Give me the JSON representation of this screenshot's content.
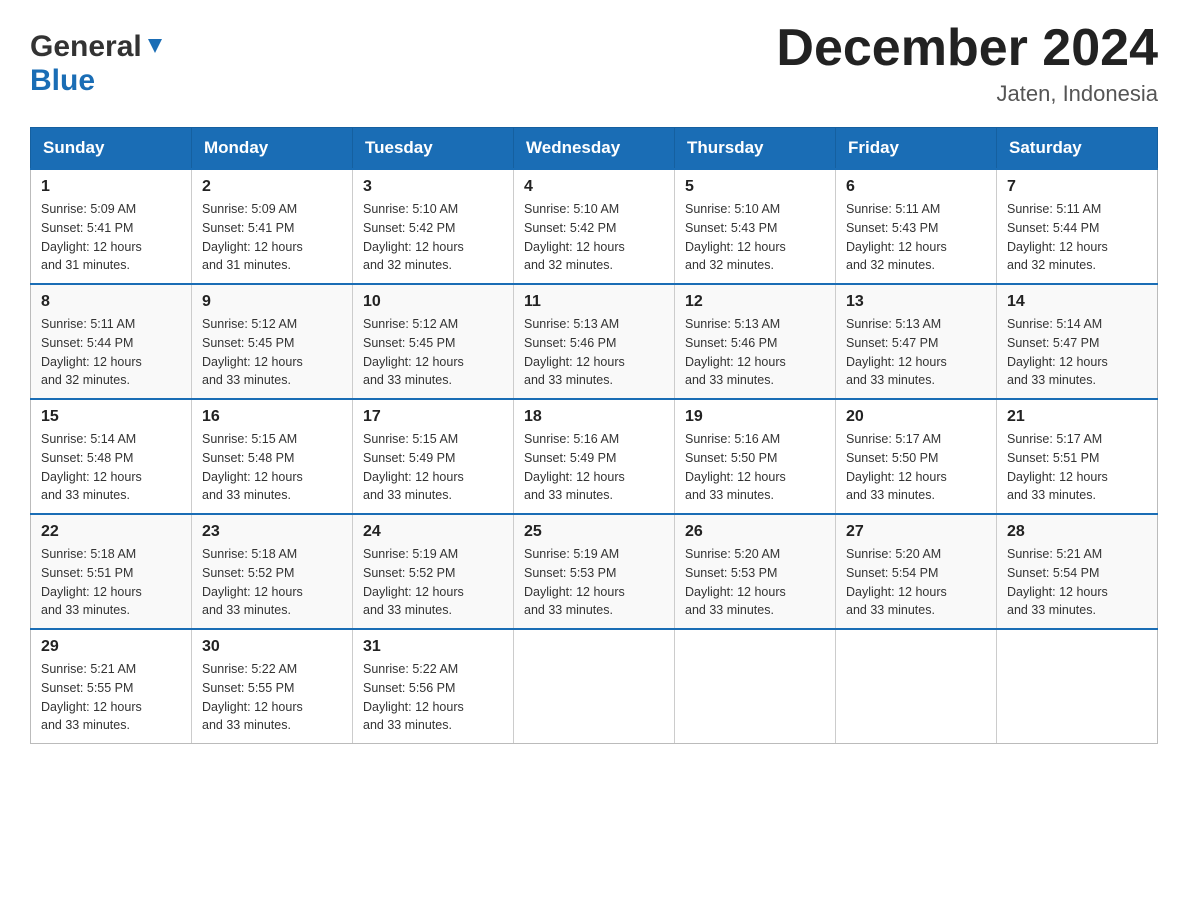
{
  "header": {
    "logo_general": "General",
    "logo_blue": "Blue",
    "title": "December 2024",
    "location": "Jaten, Indonesia"
  },
  "days_of_week": [
    "Sunday",
    "Monday",
    "Tuesday",
    "Wednesday",
    "Thursday",
    "Friday",
    "Saturday"
  ],
  "weeks": [
    [
      {
        "day": "1",
        "sunrise": "5:09 AM",
        "sunset": "5:41 PM",
        "daylight": "12 hours and 31 minutes."
      },
      {
        "day": "2",
        "sunrise": "5:09 AM",
        "sunset": "5:41 PM",
        "daylight": "12 hours and 31 minutes."
      },
      {
        "day": "3",
        "sunrise": "5:10 AM",
        "sunset": "5:42 PM",
        "daylight": "12 hours and 32 minutes."
      },
      {
        "day": "4",
        "sunrise": "5:10 AM",
        "sunset": "5:42 PM",
        "daylight": "12 hours and 32 minutes."
      },
      {
        "day": "5",
        "sunrise": "5:10 AM",
        "sunset": "5:43 PM",
        "daylight": "12 hours and 32 minutes."
      },
      {
        "day": "6",
        "sunrise": "5:11 AM",
        "sunset": "5:43 PM",
        "daylight": "12 hours and 32 minutes."
      },
      {
        "day": "7",
        "sunrise": "5:11 AM",
        "sunset": "5:44 PM",
        "daylight": "12 hours and 32 minutes."
      }
    ],
    [
      {
        "day": "8",
        "sunrise": "5:11 AM",
        "sunset": "5:44 PM",
        "daylight": "12 hours and 32 minutes."
      },
      {
        "day": "9",
        "sunrise": "5:12 AM",
        "sunset": "5:45 PM",
        "daylight": "12 hours and 33 minutes."
      },
      {
        "day": "10",
        "sunrise": "5:12 AM",
        "sunset": "5:45 PM",
        "daylight": "12 hours and 33 minutes."
      },
      {
        "day": "11",
        "sunrise": "5:13 AM",
        "sunset": "5:46 PM",
        "daylight": "12 hours and 33 minutes."
      },
      {
        "day": "12",
        "sunrise": "5:13 AM",
        "sunset": "5:46 PM",
        "daylight": "12 hours and 33 minutes."
      },
      {
        "day": "13",
        "sunrise": "5:13 AM",
        "sunset": "5:47 PM",
        "daylight": "12 hours and 33 minutes."
      },
      {
        "day": "14",
        "sunrise": "5:14 AM",
        "sunset": "5:47 PM",
        "daylight": "12 hours and 33 minutes."
      }
    ],
    [
      {
        "day": "15",
        "sunrise": "5:14 AM",
        "sunset": "5:48 PM",
        "daylight": "12 hours and 33 minutes."
      },
      {
        "day": "16",
        "sunrise": "5:15 AM",
        "sunset": "5:48 PM",
        "daylight": "12 hours and 33 minutes."
      },
      {
        "day": "17",
        "sunrise": "5:15 AM",
        "sunset": "5:49 PM",
        "daylight": "12 hours and 33 minutes."
      },
      {
        "day": "18",
        "sunrise": "5:16 AM",
        "sunset": "5:49 PM",
        "daylight": "12 hours and 33 minutes."
      },
      {
        "day": "19",
        "sunrise": "5:16 AM",
        "sunset": "5:50 PM",
        "daylight": "12 hours and 33 minutes."
      },
      {
        "day": "20",
        "sunrise": "5:17 AM",
        "sunset": "5:50 PM",
        "daylight": "12 hours and 33 minutes."
      },
      {
        "day": "21",
        "sunrise": "5:17 AM",
        "sunset": "5:51 PM",
        "daylight": "12 hours and 33 minutes."
      }
    ],
    [
      {
        "day": "22",
        "sunrise": "5:18 AM",
        "sunset": "5:51 PM",
        "daylight": "12 hours and 33 minutes."
      },
      {
        "day": "23",
        "sunrise": "5:18 AM",
        "sunset": "5:52 PM",
        "daylight": "12 hours and 33 minutes."
      },
      {
        "day": "24",
        "sunrise": "5:19 AM",
        "sunset": "5:52 PM",
        "daylight": "12 hours and 33 minutes."
      },
      {
        "day": "25",
        "sunrise": "5:19 AM",
        "sunset": "5:53 PM",
        "daylight": "12 hours and 33 minutes."
      },
      {
        "day": "26",
        "sunrise": "5:20 AM",
        "sunset": "5:53 PM",
        "daylight": "12 hours and 33 minutes."
      },
      {
        "day": "27",
        "sunrise": "5:20 AM",
        "sunset": "5:54 PM",
        "daylight": "12 hours and 33 minutes."
      },
      {
        "day": "28",
        "sunrise": "5:21 AM",
        "sunset": "5:54 PM",
        "daylight": "12 hours and 33 minutes."
      }
    ],
    [
      {
        "day": "29",
        "sunrise": "5:21 AM",
        "sunset": "5:55 PM",
        "daylight": "12 hours and 33 minutes."
      },
      {
        "day": "30",
        "sunrise": "5:22 AM",
        "sunset": "5:55 PM",
        "daylight": "12 hours and 33 minutes."
      },
      {
        "day": "31",
        "sunrise": "5:22 AM",
        "sunset": "5:56 PM",
        "daylight": "12 hours and 33 minutes."
      },
      null,
      null,
      null,
      null
    ]
  ]
}
